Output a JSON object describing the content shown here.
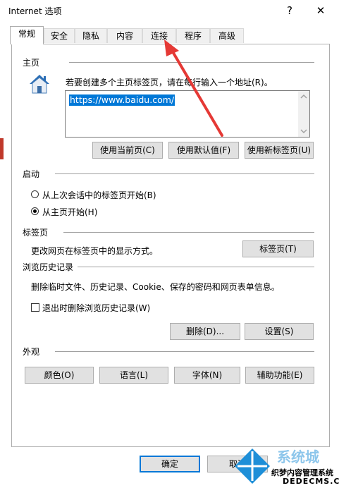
{
  "window": {
    "title": "Internet 选项",
    "help_glyph": "?",
    "close_glyph": "✕"
  },
  "tabs": [
    {
      "label": "常规",
      "active": true
    },
    {
      "label": "安全"
    },
    {
      "label": "隐私"
    },
    {
      "label": "内容"
    },
    {
      "label": "连接"
    },
    {
      "label": "程序"
    },
    {
      "label": "高级"
    }
  ],
  "homepage": {
    "section_title": "主页",
    "description": "若要创建多个主页标签页，请在每行输入一个地址(R)。",
    "url": "https://www.baidu.com/",
    "buttons": [
      "使用当前页(C)",
      "使用默认值(F)",
      "使用新标签页(U)"
    ]
  },
  "startup": {
    "section_title": "启动",
    "options": [
      {
        "label": "从上次会话中的标签页开始(B)",
        "selected": false
      },
      {
        "label": "从主页开始(H)",
        "selected": true
      }
    ]
  },
  "tabs_section": {
    "section_title": "标签页",
    "description": "更改网页在标签页中的显示方式。",
    "button": "标签页(T)"
  },
  "history": {
    "section_title": "浏览历史记录",
    "description": "删除临时文件、历史记录、Cookie、保存的密码和网页表单信息。",
    "checkbox_label": "退出时删除浏览历史记录(W)",
    "checkbox_checked": false,
    "delete_button": "删除(D)...",
    "settings_button": "设置(S)"
  },
  "appearance": {
    "section_title": "外观",
    "buttons": [
      "颜色(O)",
      "语言(L)",
      "字体(N)",
      "辅助功能(E)"
    ]
  },
  "footer": {
    "ok": "确定",
    "cancel": "取消"
  },
  "watermark": {
    "brand": "系统城",
    "site_cn": "织梦内容管理系统",
    "site_url": "DEDECMS.COM"
  },
  "colors": {
    "accent": "#0078d7",
    "annotation_arrow": "#e53935"
  }
}
